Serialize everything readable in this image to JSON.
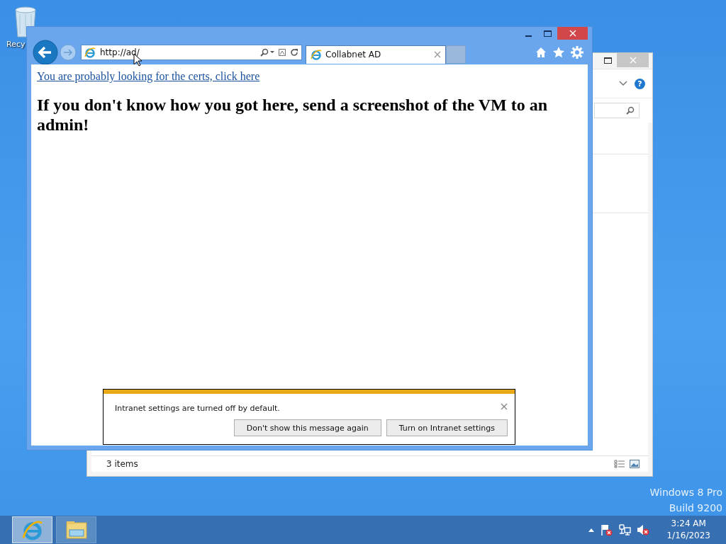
{
  "desktop": {
    "icons": [
      {
        "label": "Recy"
      }
    ],
    "os_label": [
      "Windows 8 Pro",
      "Build 9200"
    ]
  },
  "explorer_window": {
    "help": "?",
    "status_bar": {
      "item_count": "3 items"
    }
  },
  "browser": {
    "address": "http://ad/",
    "tabs": [
      {
        "title": "Collabnet AD",
        "selected": true
      }
    ],
    "page": {
      "link": "You are probably looking for the certs, click here",
      "heading": "If you don't know how you got here, send a screenshot of the VM to an admin!"
    },
    "notification": {
      "message": "Intranet settings are turned off by default.",
      "buttons": [
        "Don't show this message again",
        "Turn on Intranet settings"
      ]
    }
  },
  "taskbar": {
    "apps": [
      {
        "kind": "browser",
        "selected": true
      },
      {
        "kind": "files",
        "selected": false
      }
    ],
    "clock": {
      "time": "3:24 AM",
      "date": "1/16/2023"
    }
  }
}
